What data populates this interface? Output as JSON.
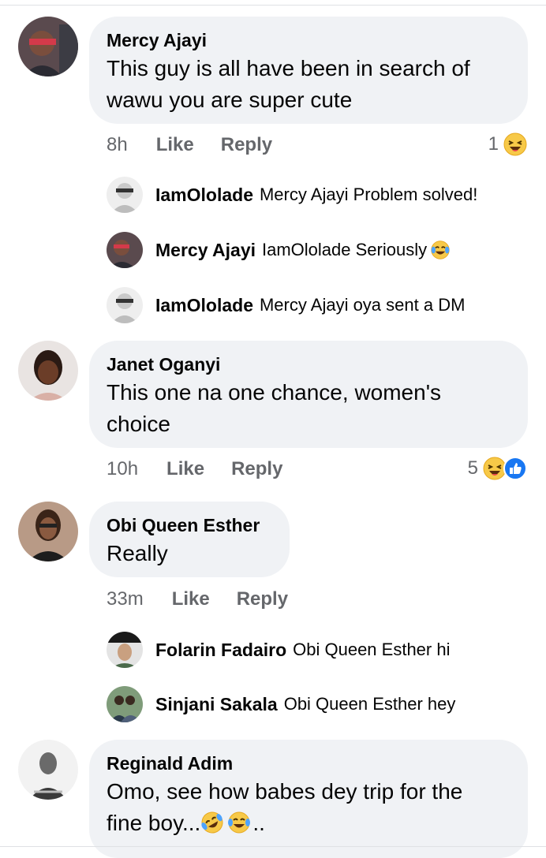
{
  "comments": [
    {
      "author": "Mercy Ajayi",
      "line1": "This guy is all have been in search of",
      "line2": "wawu you are super cute",
      "time": "8h",
      "like": "Like",
      "reply": "Reply",
      "reaction_count": "1",
      "replies": [
        {
          "author": "IamOlolade",
          "text": "Mercy Ajayi Problem solved!"
        },
        {
          "author": "Mercy Ajayi",
          "text": "IamOlolade Seriously"
        },
        {
          "author": "IamOlolade",
          "text": "Mercy Ajayi oya sent a DM"
        }
      ]
    },
    {
      "author": "Janet Oganyi",
      "line1": "This one na one chance, women's",
      "line2": "choice",
      "time": "10h",
      "like": "Like",
      "reply": "Reply",
      "reaction_count": "5"
    },
    {
      "author": "Obi Queen Esther",
      "line1": "Really",
      "time": "33m",
      "like": "Like",
      "reply": "Reply",
      "replies": [
        {
          "author": "Folarin Fadairo",
          "text": "Obi Queen Esther hi"
        },
        {
          "author": "Sinjani Sakala",
          "text": "Obi Queen Esther hey"
        }
      ]
    },
    {
      "author": "Reginald Adim",
      "line1": "Omo, see how babes dey trip for the",
      "line2a": "fine boy...",
      "line2b": ".."
    }
  ],
  "icons": {
    "haha": "haha-emoji",
    "tears_of_joy": "tears-of-joy-emoji",
    "rofl": "rofl-emoji",
    "like": "like-reaction"
  },
  "colors": {
    "bubble": "#f0f2f5",
    "meta": "#65676b",
    "like_blue": "#1877f2",
    "emoji_yellow": "#f7c948"
  }
}
